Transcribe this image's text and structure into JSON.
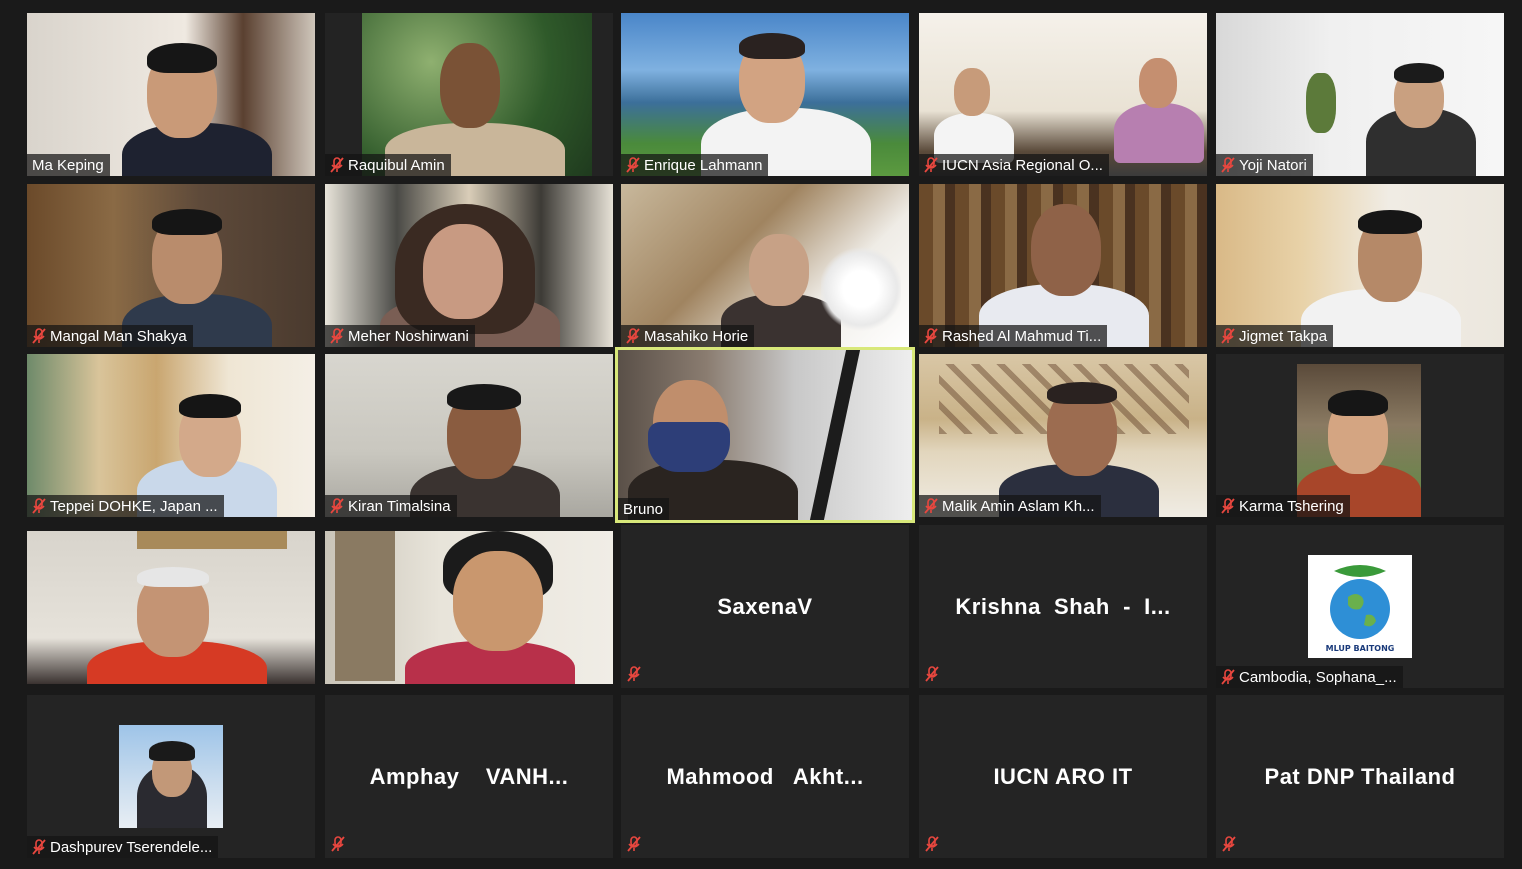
{
  "meeting": {
    "participants": [
      {
        "name": "Ma Keping",
        "muted": false,
        "video": true
      },
      {
        "name": "Raquibul Amin",
        "muted": true,
        "video": true
      },
      {
        "name": "Enrique Lahmann",
        "muted": true,
        "video": true
      },
      {
        "name": "IUCN Asia Regional O...",
        "muted": true,
        "video": true
      },
      {
        "name": "Yoji Natori",
        "muted": true,
        "video": true
      },
      {
        "name": "Mangal Man Shakya",
        "muted": true,
        "video": true
      },
      {
        "name": "Meher Noshirwani",
        "muted": true,
        "video": true
      },
      {
        "name": "Masahiko Horie",
        "muted": true,
        "video": true
      },
      {
        "name": "Rashed Al Mahmud Ti...",
        "muted": true,
        "video": true
      },
      {
        "name": "Jigmet Takpa",
        "muted": true,
        "video": true
      },
      {
        "name": "Teppei DOHKE, Japan ...",
        "muted": true,
        "video": true
      },
      {
        "name": "Kiran Timalsina",
        "muted": true,
        "video": true
      },
      {
        "name": "Bruno",
        "muted": false,
        "video": true,
        "active_speaker": true
      },
      {
        "name": "Malik Amin Aslam Kh...",
        "muted": true,
        "video": true
      },
      {
        "name": "Karma Tshering",
        "muted": true,
        "video": true
      },
      {
        "name": "",
        "muted": false,
        "video": true
      },
      {
        "name": "",
        "muted": false,
        "video": true
      },
      {
        "name": "SaxenaV",
        "muted": true,
        "video": false
      },
      {
        "name": "Krishna  Shah  -  I...",
        "muted": true,
        "video": false
      },
      {
        "name": "Cambodia, Sophana_...",
        "muted": true,
        "video": false,
        "has_logo": true
      },
      {
        "name": "Dashpurev Tserendele...",
        "muted": true,
        "video": false,
        "has_photo": true
      },
      {
        "name": "Amphay    VANH...",
        "muted": true,
        "video": false
      },
      {
        "name": "Mahmood   Akht...",
        "muted": true,
        "video": false
      },
      {
        "name": "IUCN ARO IT",
        "muted": true,
        "video": false
      },
      {
        "name": "Pat DNP Thailand",
        "muted": true,
        "video": false
      }
    ],
    "logo_text": "ម្លប់បៃតង MLUP BAITONG",
    "colors": {
      "muted_icon": "#e8473f",
      "active_border": "#d8e87a",
      "tile_bg": "#242424",
      "page_bg": "#1a1a1a"
    }
  }
}
